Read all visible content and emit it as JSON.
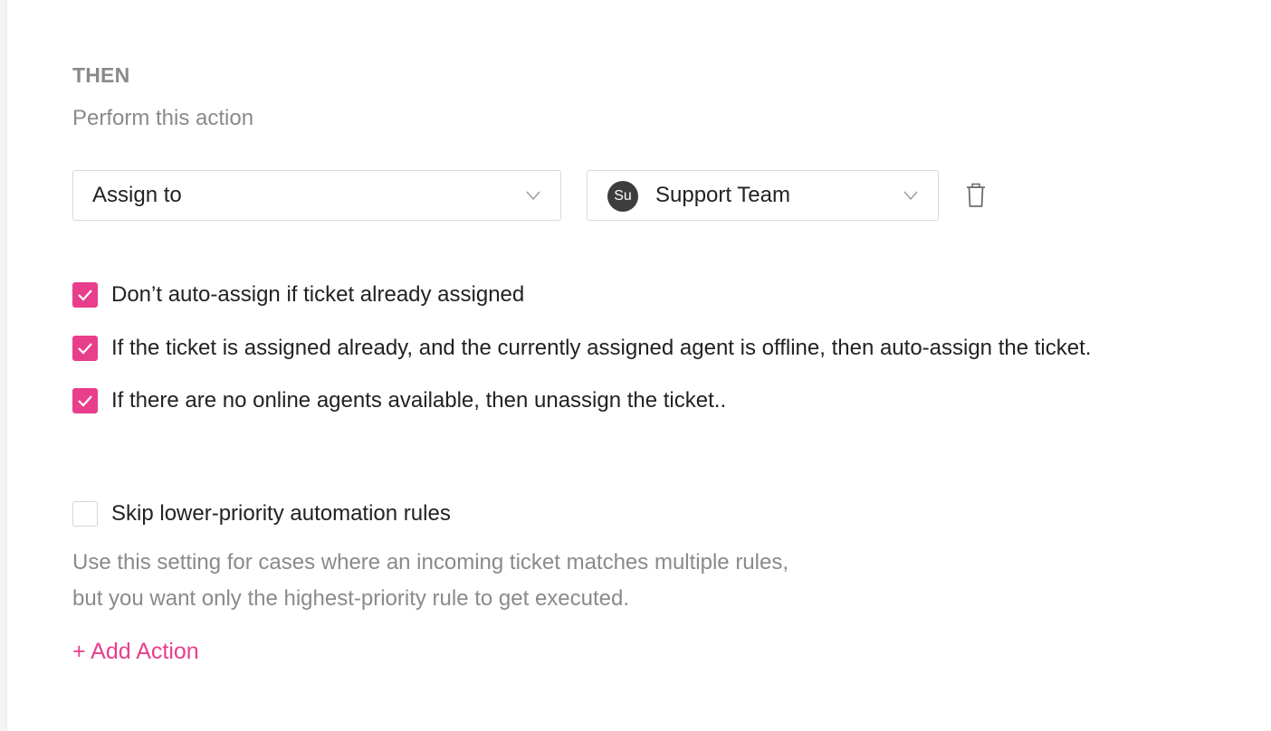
{
  "section": {
    "heading": "THEN",
    "subheading": "Perform this action"
  },
  "action_select": {
    "value": "Assign to",
    "icon": "chevron-down-icon"
  },
  "assignee_select": {
    "avatar_initials": "Su",
    "value": "Support Team",
    "icon": "chevron-down-icon"
  },
  "delete_icon": "trash-icon",
  "options": [
    {
      "label": "Don’t auto-assign if ticket already assigned",
      "checked": true
    },
    {
      "label": "If the ticket is assigned already, and the currently assigned agent is offline, then auto-assign the ticket.",
      "checked": true
    },
    {
      "label": "If there are no online agents available, then unassign the ticket..",
      "checked": true
    }
  ],
  "skip_rules": {
    "label": "Skip lower-priority automation rules",
    "checked": false,
    "help_line1": "Use this setting for cases where an incoming ticket matches multiple rules,",
    "help_line2": "but you want only the highest-priority rule to get executed."
  },
  "add_action_label": "+ Add Action",
  "colors": {
    "accent": "#e83e8c",
    "muted_text": "#8a8a8a",
    "border": "#d9d9d9"
  }
}
